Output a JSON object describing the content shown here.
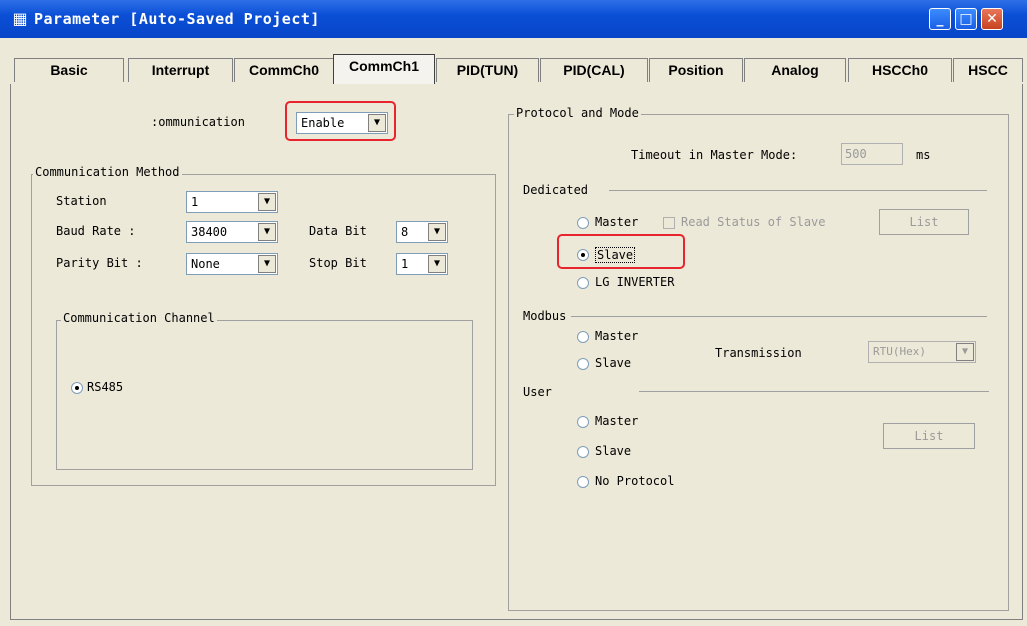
{
  "window": {
    "title": "Parameter [Auto-Saved Project]",
    "icon": "grid-icon"
  },
  "tabs": [
    {
      "label": "Basic"
    },
    {
      "label": "Interrupt"
    },
    {
      "label": "CommCh0"
    },
    {
      "label": "CommCh1"
    },
    {
      "label": "PID(TUN)"
    },
    {
      "label": "PID(CAL)"
    },
    {
      "label": "Position"
    },
    {
      "label": "Analog"
    },
    {
      "label": "HSCCh0"
    },
    {
      "label": "HSCC"
    }
  ],
  "active_tab": "CommCh1",
  "communication": {
    "label": ":ommunication",
    "value": "Enable"
  },
  "method": {
    "title": "Communication Method",
    "station": {
      "label": "Station",
      "value": "1"
    },
    "baud": {
      "label": "Baud Rate :",
      "value": "38400"
    },
    "databit": {
      "label": "Data Bit",
      "value": "8"
    },
    "parity": {
      "label": "Parity Bit :",
      "value": "None"
    },
    "stopbit": {
      "label": "Stop Bit",
      "value": "1"
    }
  },
  "channel": {
    "title": "Communication Channel",
    "option": "RS485"
  },
  "protocol": {
    "title": "Protocol and Mode",
    "timeout_label": "Timeout in Master Mode:",
    "timeout_value": "500",
    "timeout_unit": "ms",
    "dedicated": {
      "title": "Dedicated",
      "master": "Master",
      "read_status": "Read Status of Slave",
      "list": "List",
      "slave": "Slave",
      "lg_inverter": "LG INVERTER"
    },
    "modbus": {
      "title": "Modbus",
      "master": "Master",
      "slave": "Slave",
      "transmission_label": "Transmission",
      "transmission_value": "RTU(Hex)"
    },
    "user": {
      "title": "User",
      "master": "Master",
      "slave": "Slave",
      "no_protocol": "No Protocol",
      "list": "List"
    }
  },
  "colors": {
    "highlight": "#E8242E",
    "titlebar": "#0A4FD6"
  }
}
